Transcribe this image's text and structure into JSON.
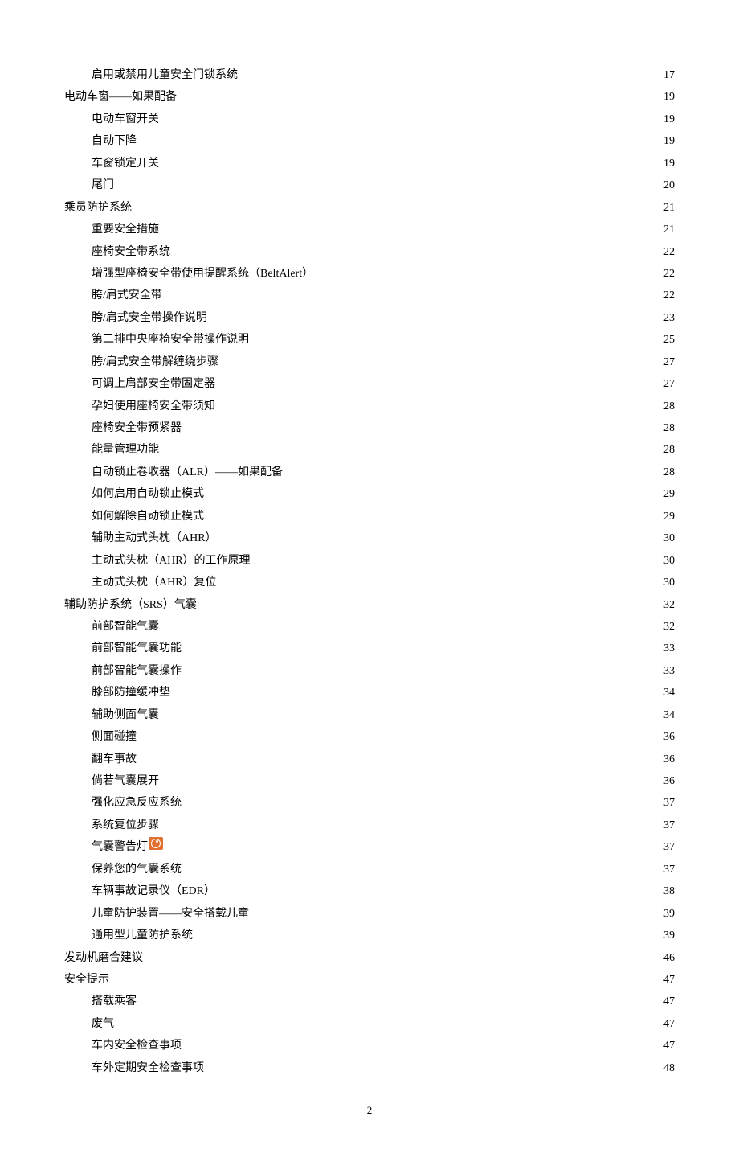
{
  "page_number": "2",
  "entries": [
    {
      "level": 2,
      "title": "启用或禁用儿童安全门锁系统",
      "page": "17"
    },
    {
      "level": 1,
      "title": "电动车窗——如果配备",
      "page": "19"
    },
    {
      "level": 2,
      "title": "电动车窗开关",
      "page": "19"
    },
    {
      "level": 2,
      "title": "自动下降",
      "page": "19"
    },
    {
      "level": 2,
      "title": "车窗锁定开关",
      "page": "19"
    },
    {
      "level": 2,
      "title": "尾门",
      "page": "20"
    },
    {
      "level": 1,
      "title": "乘员防护系统",
      "page": "21"
    },
    {
      "level": 2,
      "title": "重要安全措施",
      "page": "21"
    },
    {
      "level": 2,
      "title": "座椅安全带系统",
      "page": "22"
    },
    {
      "level": 2,
      "title": "增强型座椅安全带使用提醒系统（BeltAlert）",
      "page": "22"
    },
    {
      "level": 2,
      "title": "胯/肩式安全带",
      "page": "22"
    },
    {
      "level": 2,
      "title": "胯/肩式安全带操作说明",
      "page": "23"
    },
    {
      "level": 2,
      "title": "第二排中央座椅安全带操作说明",
      "page": "25"
    },
    {
      "level": 2,
      "title": "胯/肩式安全带解缠绕步骤",
      "page": "27"
    },
    {
      "level": 2,
      "title": "可调上肩部安全带固定器",
      "page": "27"
    },
    {
      "level": 2,
      "title": "孕妇使用座椅安全带须知",
      "page": "28"
    },
    {
      "level": 2,
      "title": "座椅安全带预紧器",
      "page": "28"
    },
    {
      "level": 2,
      "title": "能量管理功能",
      "page": "28"
    },
    {
      "level": 2,
      "title": "自动锁止卷收器（ALR）——如果配备",
      "page": "28"
    },
    {
      "level": 2,
      "title": "如何启用自动锁止模式",
      "page": "29"
    },
    {
      "level": 2,
      "title": "如何解除自动锁止模式",
      "page": "29"
    },
    {
      "level": 2,
      "title": "辅助主动式头枕（AHR）",
      "page": "30"
    },
    {
      "level": 2,
      "title": "主动式头枕（AHR）的工作原理",
      "page": "30"
    },
    {
      "level": 2,
      "title": "主动式头枕（AHR）复位",
      "page": "30"
    },
    {
      "level": 1,
      "title": "辅助防护系统（SRS）气囊",
      "page": "32"
    },
    {
      "level": 2,
      "title": "前部智能气囊",
      "page": "32"
    },
    {
      "level": 2,
      "title": "前部智能气囊功能",
      "page": "33"
    },
    {
      "level": 2,
      "title": "前部智能气囊操作",
      "page": "33"
    },
    {
      "level": 2,
      "title": "膝部防撞缓冲垫",
      "page": "34"
    },
    {
      "level": 2,
      "title": "辅助侧面气囊",
      "page": "34"
    },
    {
      "level": 2,
      "title": "侧面碰撞",
      "page": "36"
    },
    {
      "level": 2,
      "title": "翻车事故",
      "page": "36"
    },
    {
      "level": 2,
      "title": "倘若气囊展开",
      "page": "36"
    },
    {
      "level": 2,
      "title": "强化应急反应系统",
      "page": "37"
    },
    {
      "level": 2,
      "title": "系统复位步骤",
      "page": "37"
    },
    {
      "level": 2,
      "title": "气囊警告灯",
      "page": "37",
      "icon": "airbag"
    },
    {
      "level": 2,
      "title": "保养您的气囊系统",
      "page": "37"
    },
    {
      "level": 2,
      "title": "车辆事故记录仪（EDR）",
      "page": "38"
    },
    {
      "level": 2,
      "title": "儿童防护装置——安全搭载儿童",
      "page": "39"
    },
    {
      "level": 2,
      "title": "通用型儿童防护系统",
      "page": "39"
    },
    {
      "level": 1,
      "title": "发动机磨合建议",
      "page": "46"
    },
    {
      "level": 1,
      "title": "安全提示",
      "page": "47"
    },
    {
      "level": 2,
      "title": "搭载乘客",
      "page": "47"
    },
    {
      "level": 2,
      "title": "废气",
      "page": "47"
    },
    {
      "level": 2,
      "title": "车内安全检查事项",
      "page": "47"
    },
    {
      "level": 2,
      "title": "车外定期安全检查事项",
      "page": "48"
    }
  ]
}
